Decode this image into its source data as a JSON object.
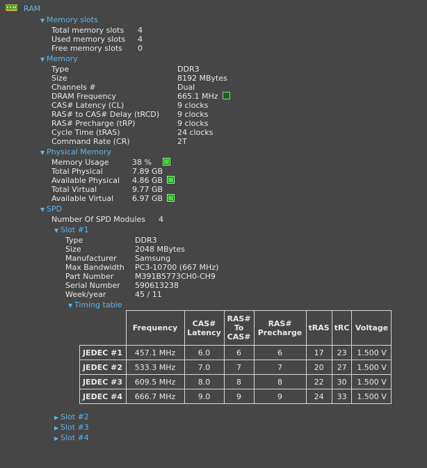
{
  "root_label": "RAM",
  "memory_slots": {
    "header": "Memory slots",
    "rows": [
      {
        "label": "Total memory slots",
        "value": "4"
      },
      {
        "label": "Used memory slots",
        "value": "4"
      },
      {
        "label": "Free memory slots",
        "value": "0"
      }
    ]
  },
  "memory": {
    "header": "Memory",
    "rows": [
      {
        "label": "Type",
        "value": "DDR3"
      },
      {
        "label": "Size",
        "value": "8192 MBytes"
      },
      {
        "label": "Channels #",
        "value": "Dual"
      },
      {
        "label": "DRAM Frequency",
        "value": "665.1 MHz"
      },
      {
        "label": "CAS# Latency (CL)",
        "value": "9 clocks"
      },
      {
        "label": "RAS# to CAS# Delay (tRCD)",
        "value": "9 clocks"
      },
      {
        "label": "RAS# Precharge (tRP)",
        "value": "9 clocks"
      },
      {
        "label": "Cycle Time (tRAS)",
        "value": "24 clocks"
      },
      {
        "label": "Command Rate (CR)",
        "value": "2T"
      }
    ]
  },
  "physical_memory": {
    "header": "Physical Memory",
    "rows": [
      {
        "label": "Memory Usage",
        "value": "38 %"
      },
      {
        "label": "Total Physical",
        "value": "7.89 GB"
      },
      {
        "label": "Available Physical",
        "value": "4.86 GB"
      },
      {
        "label": "Total Virtual",
        "value": "9.77 GB"
      },
      {
        "label": "Available Virtual",
        "value": "6.97 GB"
      }
    ]
  },
  "spd": {
    "header": "SPD",
    "modules_label": "Number Of SPD Modules",
    "modules_value": "4",
    "slot1": {
      "header": "Slot #1",
      "rows": [
        {
          "label": "Type",
          "value": "DDR3"
        },
        {
          "label": "Size",
          "value": "2048 MBytes"
        },
        {
          "label": "Manufacturer",
          "value": "Samsung"
        },
        {
          "label": "Max Bandwidth",
          "value": "PC3-10700 (667 MHz)"
        },
        {
          "label": "Part Number",
          "value": "M391B5773CH0-CH9"
        },
        {
          "label": "Serial Number",
          "value": "590613238"
        },
        {
          "label": "Week/year",
          "value": "45 / 11"
        }
      ],
      "timing_header": "Timing table",
      "timing": {
        "columns": [
          "Frequency",
          "CAS# Latency",
          "RAS# To CAS#",
          "RAS# Precharge",
          "tRAS",
          "tRC",
          "Voltage"
        ],
        "rows": [
          {
            "name": "JEDEC #1",
            "cells": [
              "457.1 MHz",
              "6.0",
              "6",
              "6",
              "17",
              "23",
              "1.500 V"
            ]
          },
          {
            "name": "JEDEC #2",
            "cells": [
              "533.3 MHz",
              "7.0",
              "7",
              "7",
              "20",
              "27",
              "1.500 V"
            ]
          },
          {
            "name": "JEDEC #3",
            "cells": [
              "609.5 MHz",
              "8.0",
              "8",
              "8",
              "22",
              "30",
              "1.500 V"
            ]
          },
          {
            "name": "JEDEC #4",
            "cells": [
              "666.7 MHz",
              "9.0",
              "9",
              "9",
              "24",
              "33",
              "1.500 V"
            ]
          }
        ]
      }
    },
    "other_slots": [
      "Slot #2",
      "Slot #3",
      "Slot #4"
    ]
  },
  "indicator_color": "#3ddc3d"
}
